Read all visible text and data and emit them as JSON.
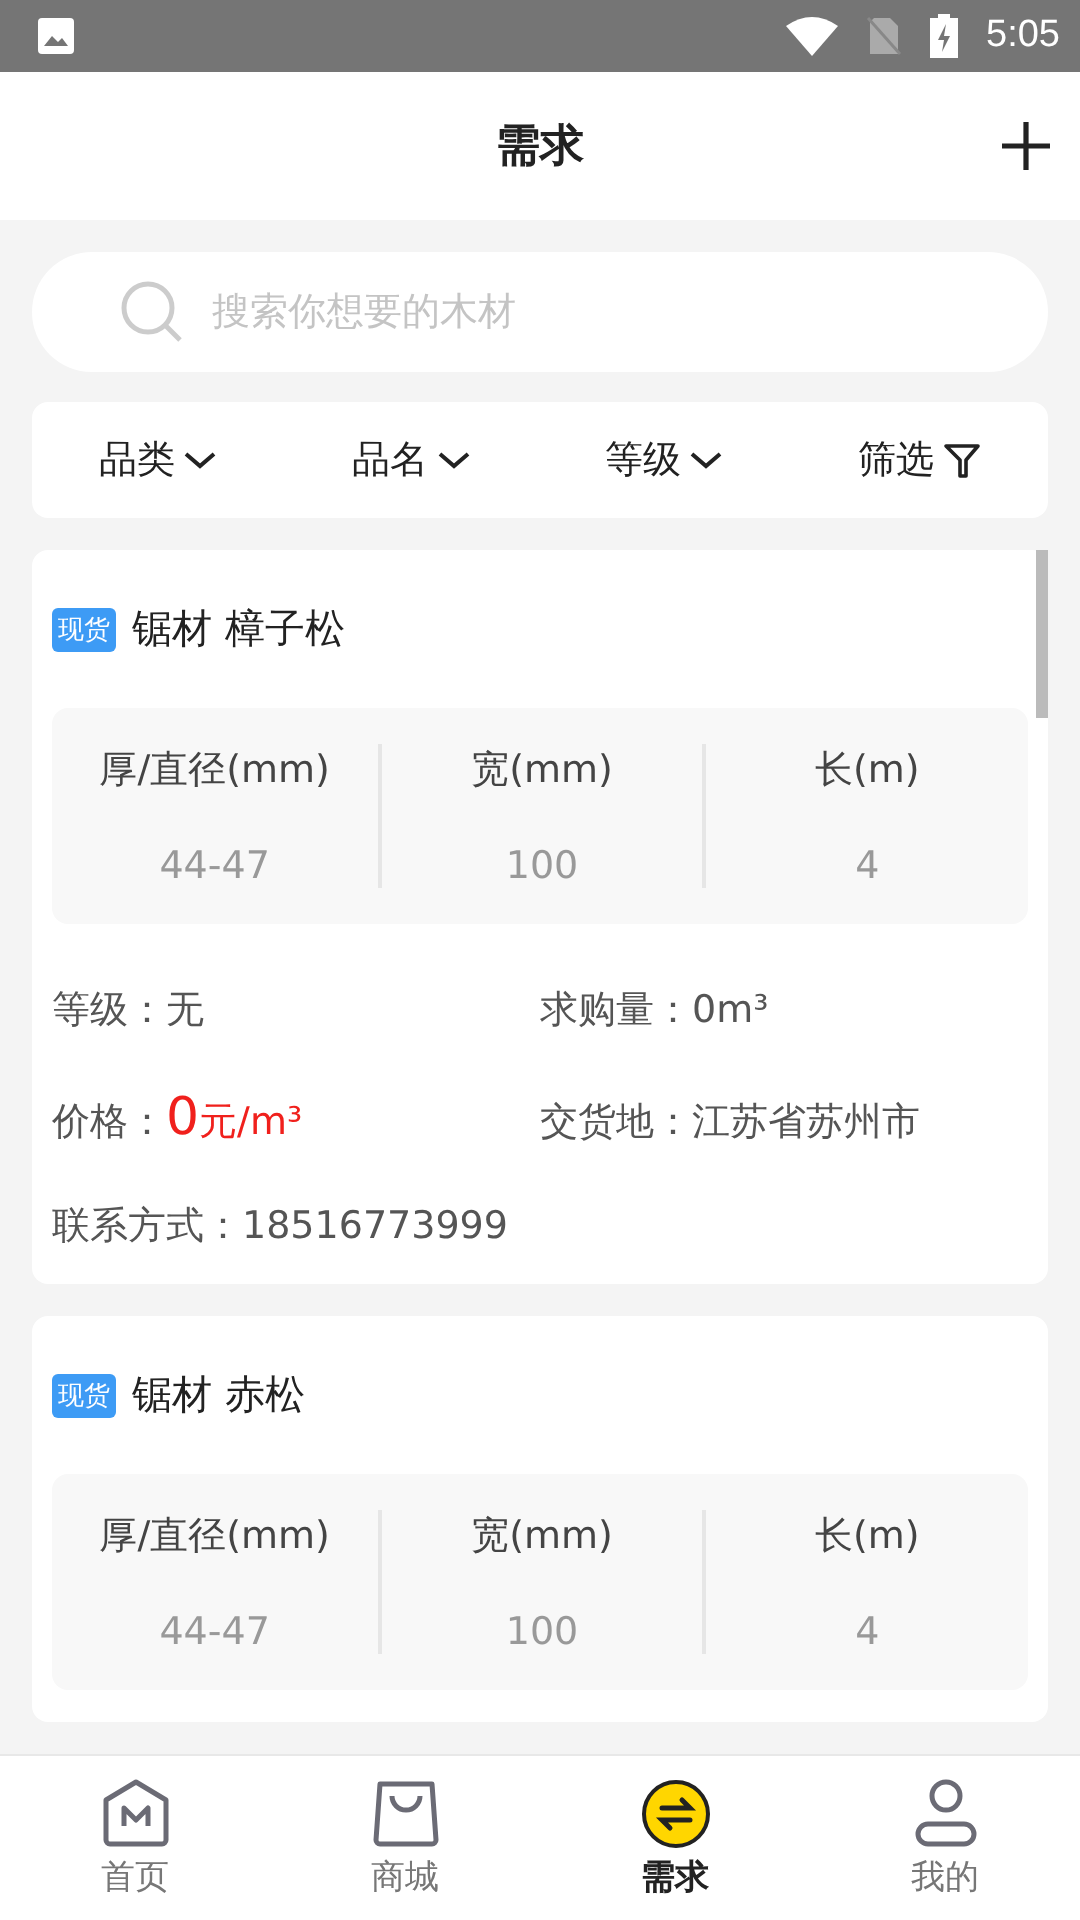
{
  "status_bar": {
    "time": "5:05"
  },
  "header": {
    "title": "需求"
  },
  "search": {
    "placeholder": "搜索你想要的木材"
  },
  "filters": [
    {
      "label": "品类",
      "kind": "dropdown"
    },
    {
      "label": "品名",
      "kind": "dropdown"
    },
    {
      "label": "等级",
      "kind": "dropdown"
    },
    {
      "label": "筛选",
      "kind": "filter"
    }
  ],
  "listings": [
    {
      "badge": "现货",
      "title": "锯材 樟子松",
      "specs": [
        {
          "label": "厚/直径(mm)",
          "value": "44-47"
        },
        {
          "label": "宽(mm)",
          "value": "100"
        },
        {
          "label": "长(m)",
          "value": "4"
        }
      ],
      "grade": {
        "label": "等级：",
        "value": "无"
      },
      "quantity": {
        "label": "求购量：",
        "value": "0m³"
      },
      "price": {
        "label": "价格：",
        "value": "0",
        "unit": "元/m³"
      },
      "delivery": {
        "label": "交货地：",
        "value": "江苏省苏州市"
      },
      "contact": {
        "label": "联系方式：",
        "value": "18516773999"
      }
    },
    {
      "badge": "现货",
      "title": "锯材 赤松",
      "specs": [
        {
          "label": "厚/直径(mm)",
          "value": "44-47"
        },
        {
          "label": "宽(mm)",
          "value": "100"
        },
        {
          "label": "长(m)",
          "value": "4"
        }
      ]
    }
  ],
  "tab_bar": [
    {
      "label": "首页",
      "kind": "home",
      "selected": false
    },
    {
      "label": "商城",
      "kind": "shop",
      "selected": false
    },
    {
      "label": "需求",
      "kind": "exchange",
      "selected": true
    },
    {
      "label": "我的",
      "kind": "user",
      "selected": false
    }
  ]
}
